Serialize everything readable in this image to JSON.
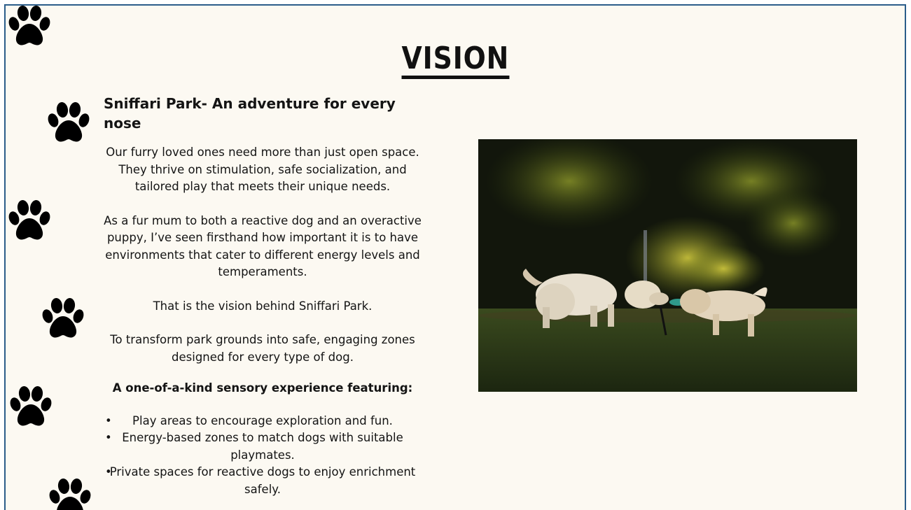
{
  "slide": {
    "title": "VISION",
    "subtitle": "Sniffari Park- An adventure for every nose",
    "paragraphs": [
      "Our furry loved ones need more than just open space. They thrive on stimulation, safe socialization, and tailored play that meets their unique needs.",
      "As a fur mum to both a reactive dog and an overactive puppy, I’ve seen firsthand how important it is to have environments that cater to different energy levels and temperaments.",
      "That is the vision behind Sniffari Park.",
      "To transform park grounds into safe, engaging zones designed for every type of dog."
    ],
    "features_heading": "A one-of-a-kind sensory experience featuring:",
    "features": [
      "Play areas to encourage exploration and fun.",
      "Energy-based zones to match dogs with suitable playmates.",
      "Private spaces for reactive dogs to enjoy enrichment safely."
    ],
    "bullet": "•"
  },
  "decorations": {
    "paw_icon": "paw-print-icon",
    "paw_color": "#000000"
  },
  "photo": {
    "subject": "two-dogs-playing-tug-photo"
  },
  "colors": {
    "background": "#fcf9f2",
    "border": "#2b5d8a",
    "text": "#141414"
  }
}
